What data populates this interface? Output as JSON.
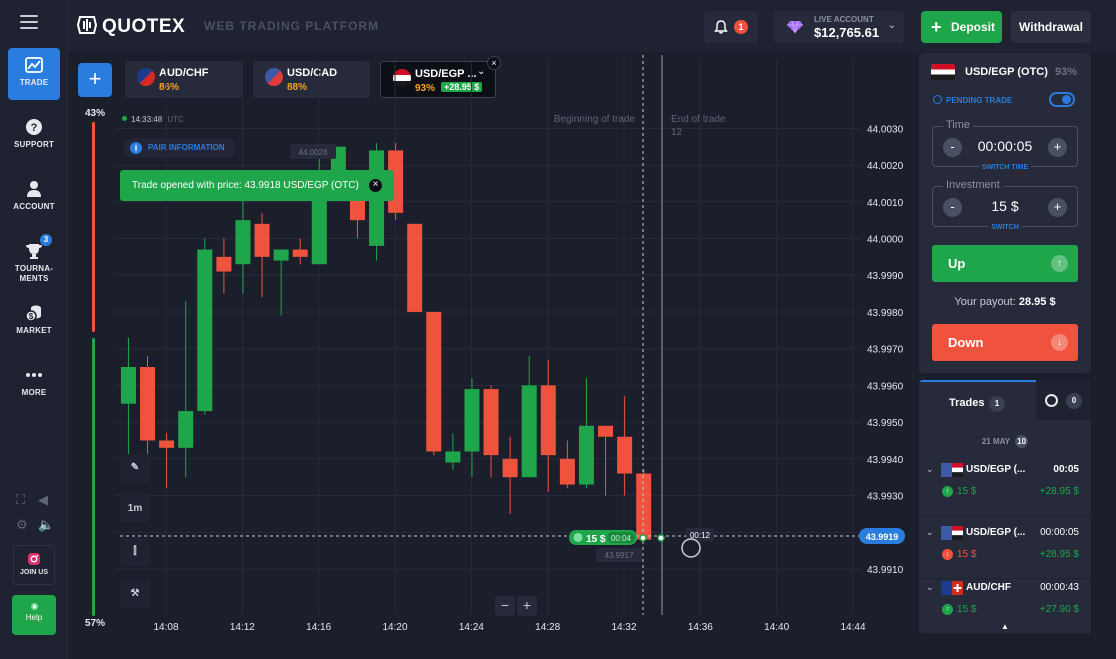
{
  "sidebar": {
    "items": [
      {
        "label": "TRADE",
        "icon": "chart-icon"
      },
      {
        "label": "SUPPORT",
        "icon": "question-icon"
      },
      {
        "label": "ACCOUNT",
        "icon": "user-icon"
      },
      {
        "label": "TOURNA-",
        "label2": "MENTS",
        "icon": "trophy-icon",
        "badge": "3"
      },
      {
        "label": "MARKET",
        "icon": "coins-icon"
      },
      {
        "label": "MORE",
        "icon": "dots-icon"
      }
    ],
    "join_us": "JOIN US",
    "help": "Help"
  },
  "header": {
    "logo": "QUOTEX",
    "platform": "WEB TRADING PLATFORM",
    "notifications": "1",
    "account_label": "LIVE ACCOUNT",
    "balance": "$12,765.61",
    "deposit": "Deposit",
    "withdrawal": "Withdrawal"
  },
  "tabs": [
    {
      "name": "AUD/CHF",
      "pct": "86%"
    },
    {
      "name": "USD/CAD",
      "pct": "88%"
    },
    {
      "name": "USD/EGP ...",
      "pct": "93%",
      "return": "+28.95 $"
    }
  ],
  "chart": {
    "server_time": "14:33:48",
    "tz": "UTC",
    "pair_info": "PAIR INFORMATION",
    "toast": "Trade opened with price: 43.9918 USD/EGP (OTC)",
    "sentiment_up": "57%",
    "sentiment_down": "43%",
    "beginning_label": "Beginning of trade",
    "end_label": "End of trade",
    "end_seconds": "12",
    "high_marker": "44.0028",
    "entry_marker": "43.9917",
    "trade_badge_amount": "15 $",
    "trade_badge_time": "00:04",
    "timer": "00:12",
    "current_price": "43.9919",
    "timeframe": "1m",
    "zoom_minus": "−",
    "zoom_plus": "+",
    "accent": "#2a7cde",
    "up_color": "#1fa64b",
    "down_color": "#f0533d"
  },
  "chart_data": {
    "type": "candlestick",
    "y_ticks": [
      "44.0030",
      "44.0020",
      "44.0010",
      "44.0000",
      "43.9990",
      "43.9980",
      "43.9970",
      "43.9960",
      "43.9950",
      "43.9940",
      "43.9930",
      "43.9920",
      "43.9910"
    ],
    "x_ticks": [
      "14:08",
      "14:12",
      "14:16",
      "14:20",
      "14:24",
      "14:28",
      "14:32",
      "14:36",
      "14:40",
      "14:44"
    ],
    "ylim": [
      43.9907,
      44.0035
    ],
    "candles": [
      {
        "o": 43.9955,
        "c": 43.9965,
        "h": 43.9973,
        "l": 43.994
      },
      {
        "o": 43.9965,
        "c": 43.9945,
        "h": 43.9968,
        "l": 43.994
      },
      {
        "o": 43.9945,
        "c": 43.9943,
        "h": 43.9947,
        "l": 43.9932
      },
      {
        "o": 43.9943,
        "c": 43.9953,
        "h": 43.9983,
        "l": 43.9935
      },
      {
        "o": 43.9953,
        "c": 43.9997,
        "h": 44.0,
        "l": 43.9952
      },
      {
        "o": 43.9995,
        "c": 43.9991,
        "h": 44.0,
        "l": 43.9985
      },
      {
        "o": 43.9993,
        "c": 44.0005,
        "h": 44.0013,
        "l": 43.9985
      },
      {
        "o": 44.0004,
        "c": 43.9995,
        "h": 44.0007,
        "l": 43.9984
      },
      {
        "o": 43.9994,
        "c": 43.9997,
        "h": 43.9997,
        "l": 43.9979
      },
      {
        "o": 43.9997,
        "c": 43.9995,
        "h": 44.0,
        "l": 43.9993
      },
      {
        "o": 43.9993,
        "c": 44.0014,
        "h": 44.0022,
        "l": 43.9993
      },
      {
        "o": 44.0015,
        "c": 44.0025,
        "h": 44.0025,
        "l": 44.0013
      },
      {
        "o": 44.0014,
        "c": 44.0005,
        "h": 44.0016,
        "l": 44.0
      },
      {
        "o": 43.9998,
        "c": 44.0024,
        "h": 44.0026,
        "l": 43.9994
      },
      {
        "o": 44.0024,
        "c": 44.0007,
        "h": 44.0026,
        "l": 44.0005
      },
      {
        "o": 44.0004,
        "c": 43.998,
        "h": 44.0004,
        "l": 43.998
      },
      {
        "o": 43.998,
        "c": 43.9942,
        "h": 43.998,
        "l": 43.9941
      },
      {
        "o": 43.9939,
        "c": 43.9942,
        "h": 43.9947,
        "l": 43.9937
      },
      {
        "o": 43.9942,
        "c": 43.9959,
        "h": 43.9962,
        "l": 43.9935
      },
      {
        "o": 43.9959,
        "c": 43.9941,
        "h": 43.996,
        "l": 43.9935
      },
      {
        "o": 43.994,
        "c": 43.9935,
        "h": 43.9946,
        "l": 43.9925
      },
      {
        "o": 43.9935,
        "c": 43.996,
        "h": 43.9968,
        "l": 43.9935
      },
      {
        "o": 43.996,
        "c": 43.9941,
        "h": 43.9967,
        "l": 43.9931
      },
      {
        "o": 43.994,
        "c": 43.9933,
        "h": 43.9945,
        "l": 43.9932
      },
      {
        "o": 43.9933,
        "c": 43.9949,
        "h": 43.9962,
        "l": 43.9932
      },
      {
        "o": 43.9949,
        "c": 43.9946,
        "h": 43.9949,
        "l": 43.993
      },
      {
        "o": 43.9946,
        "c": 43.9936,
        "h": 43.9957,
        "l": 43.993
      },
      {
        "o": 43.9936,
        "c": 43.9918,
        "h": 43.9937,
        "l": 43.9918
      }
    ],
    "first_candle_time": "14:07:00",
    "candle_minutes": 1
  },
  "trade_panel": {
    "asset": "USD/EGP (OTC)",
    "payout_pct": "93%",
    "pending": "PENDING TRADE",
    "time_label": "Time",
    "time_value": "00:00:05",
    "switch_time": "SWITCH TIME",
    "investment_label": "Investment",
    "investment_value": "15 $",
    "switch": "SWITCH",
    "minus": "-",
    "plus": "+",
    "up": "Up",
    "payout_label": "Your payout:",
    "payout_value": "28.95 $",
    "down": "Down"
  },
  "trades": {
    "tab_label": "Trades",
    "count": "1",
    "history_count": "0",
    "date": "21 MAY",
    "date_count": "10",
    "rows": [
      {
        "name": "USD/EGP (...",
        "time": "00:05",
        "amount": "15 $",
        "profit": "+28.95 $",
        "direction": "up"
      },
      {
        "name": "USD/EGP (...",
        "time": "00:00:05",
        "amount": "15 $",
        "profit": "+28.95 $",
        "direction": "down"
      },
      {
        "name": "AUD/CHF",
        "time": "00:00:43",
        "amount": "15 $",
        "profit": "+27.90 $",
        "direction": "up"
      }
    ]
  }
}
